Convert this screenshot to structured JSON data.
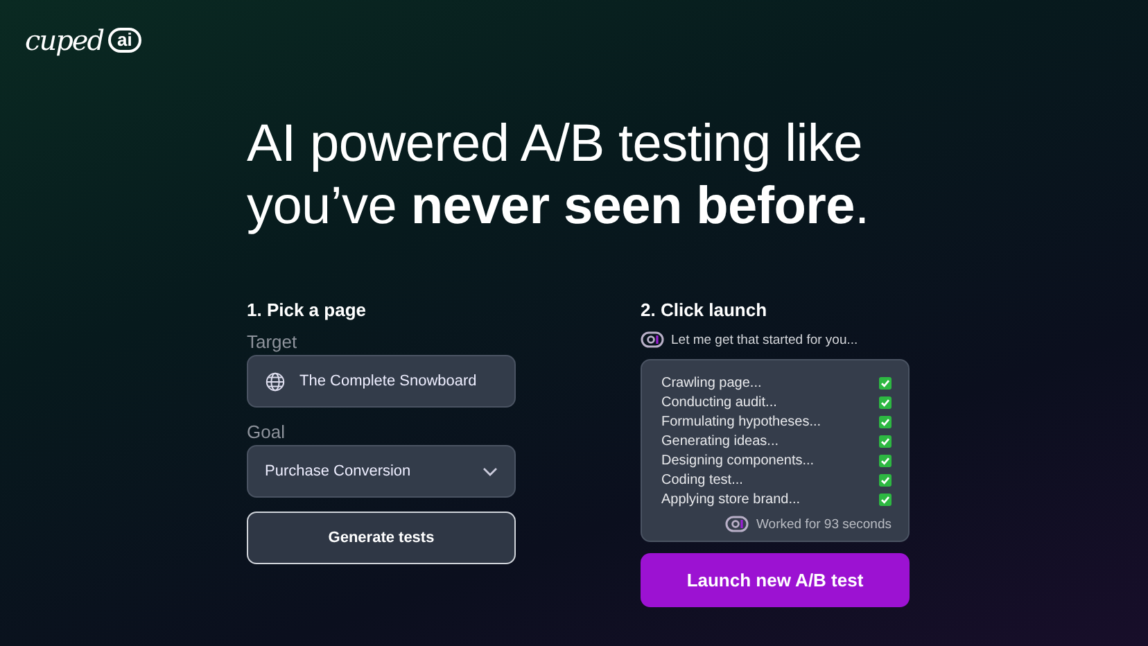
{
  "logo": {
    "word": "cuped",
    "badge": "ai"
  },
  "headline": "AI powered A/B testing like you’ve **never seen before**.",
  "pick": {
    "title": "1. Pick a page",
    "target_label": "Target",
    "target_value": "The Complete Snowboard",
    "goal_label": "Goal",
    "goal_value": "Purchase Conversion",
    "button": "Generate tests"
  },
  "launch": {
    "title": "2. Click launch",
    "message": "Let me get that started for you...",
    "steps": [
      {
        "label": "Crawling page...",
        "checked": true
      },
      {
        "label": "Conducting audit...",
        "checked": true
      },
      {
        "label": "Formulating hypotheses...",
        "checked": true
      },
      {
        "label": "Generating ideas...",
        "checked": true
      },
      {
        "label": "Designing components...",
        "checked": true
      },
      {
        "label": "Coding test...",
        "checked": true
      },
      {
        "label": "Applying store brand...",
        "checked": true
      }
    ],
    "footer": "Worked for 93 seconds",
    "button": "Launch new A/B test"
  }
}
